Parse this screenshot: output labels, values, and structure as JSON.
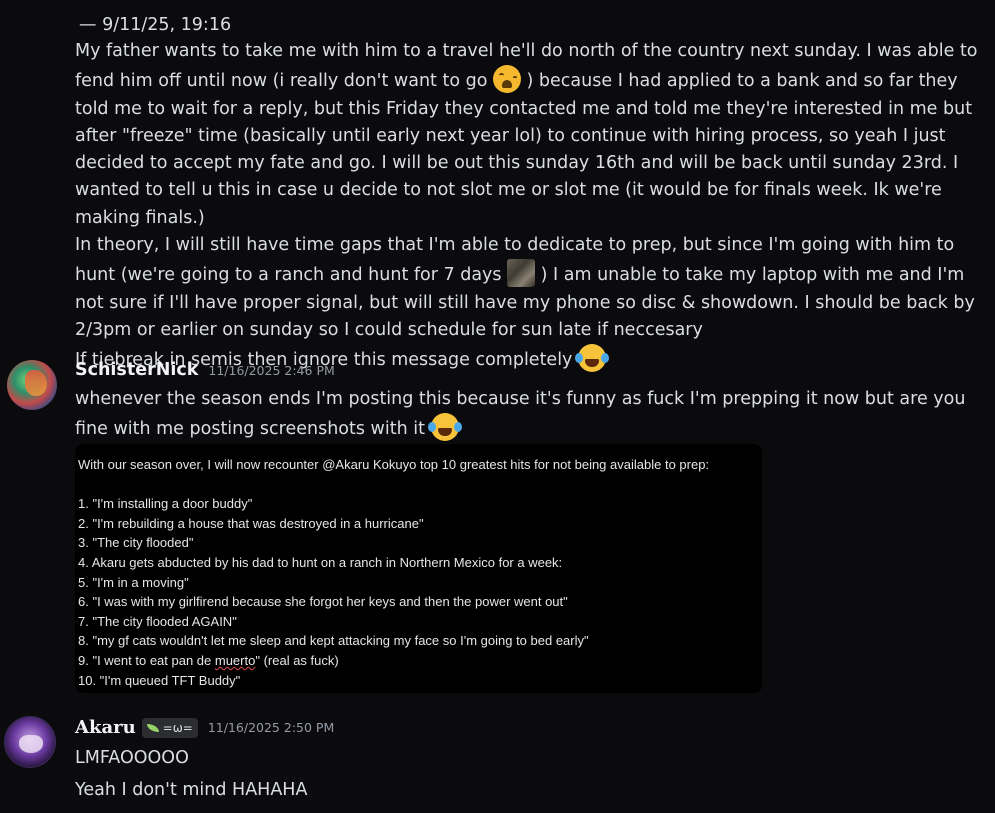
{
  "quoted": {
    "header": "— 9/11/25, 19:16",
    "paragraphs": [
      {
        "before": "My father wants to take me with him to a travel he'll do north of the country next sunday. I was able to fend him off until now (i really don't want to go ",
        "emoji": "weary-face-emoji",
        "after": " ) because I had applied to a bank and so far they told me to wait for a reply, but this Friday they contacted me and told me they're interested in me but after \"freeze\" time (basically until early next year lol) to continue with hiring process, so yeah I just decided to accept my fate and go. I will be out this sunday 16th and will be back until sunday 23rd. I wanted to tell u this in case u decide to not slot me or slot me (it would be for finals week. Ik we're making finals.)"
      },
      {
        "before": "In theory, I will still have time gaps that I'm able to dedicate to prep, but since I'm going with him to hunt (we're going to a ranch and hunt for 7 days ",
        "emoji": "custom-emoji",
        "after": " ) I am unable to take my laptop with me and I'm not sure if I'll have proper signal, but will still have my phone so disc & showdown. I should be back by 2/3pm or earlier on sunday so I could schedule for sun late if neccesary"
      },
      {
        "before": "If tiebreak in semis then ignore this message completely ",
        "emoji": "joy-emoji",
        "after": ""
      }
    ]
  },
  "schister": {
    "username": "SchisterNick",
    "timestamp": "11/16/2025 2:46 PM",
    "text": "whenever the season ends I'm posting this because it's funny as fuck I'm prepping it now but are you fine with me posting screenshots with it ",
    "emoji": "joy-emoji",
    "attachment": {
      "intro": "With our season over, I will now recounter @Akaru Kokuyo  top 10 greatest hits for not being available to prep:",
      "items": [
        "1. \"I'm installing a door buddy\"",
        "2. \"I'm rebuilding a house that was destroyed in a hurricane\"",
        "3. \"The city flooded\"",
        "4. Akaru gets abducted by his dad to hunt on a ranch in Northern Mexico for a week:",
        "5. \"I'm in a moving\"",
        "6. \"I was with my girlfirend because she forgot her keys and then the power went out\"",
        "7. \"The city flooded AGAIN\"",
        "8. \"my gf cats wouldn't let me sleep and kept attacking my face so I'm going to bed early\"",
        "9. \"I went to eat pan de muerto\" (real as fuck)",
        "10. \"I'm queued TFT Buddy\""
      ],
      "item9_before": "9. \"I went to eat pan de ",
      "item9_squiggle": "muerto",
      "item9_after": "\" (real as fuck)"
    }
  },
  "akaru": {
    "username": "Akaru",
    "tag": "=ω=",
    "timestamp": "11/16/2025 2:50 PM",
    "lines": [
      "LMFAOOOOO",
      "Yeah I don't mind HAHAHA"
    ]
  }
}
